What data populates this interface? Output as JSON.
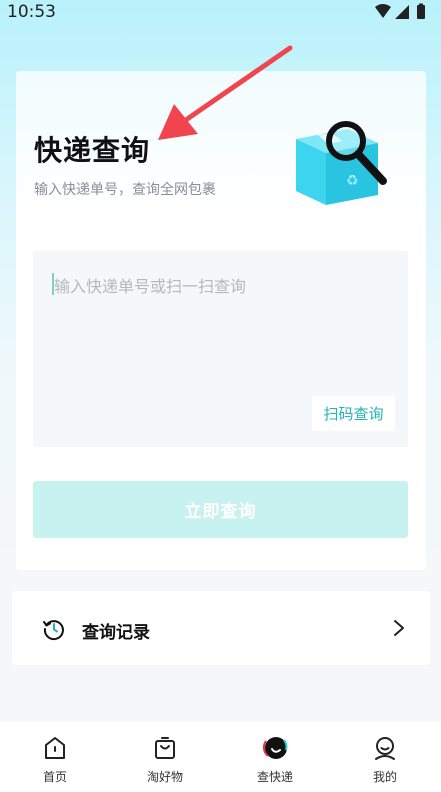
{
  "status": {
    "time": "10:53"
  },
  "card": {
    "title": "快递查询",
    "subtitle": "输入快递单号，查询全网包裹",
    "input_placeholder": "输入快递单号或扫一扫查询",
    "scan_label": "扫码查询",
    "submit_label": "立即查询"
  },
  "history": {
    "label": "查询记录"
  },
  "tabs": [
    {
      "label": "首页",
      "icon": "home-icon"
    },
    {
      "label": "淘好物",
      "icon": "shopping-bag-icon"
    },
    {
      "label": "查快递",
      "icon": "express-query-icon"
    },
    {
      "label": "我的",
      "icon": "profile-icon"
    }
  ],
  "colors": {
    "accent": "#1fb5b5",
    "button_disabled": "#c8f2f0",
    "arrow": "#f0454f"
  }
}
